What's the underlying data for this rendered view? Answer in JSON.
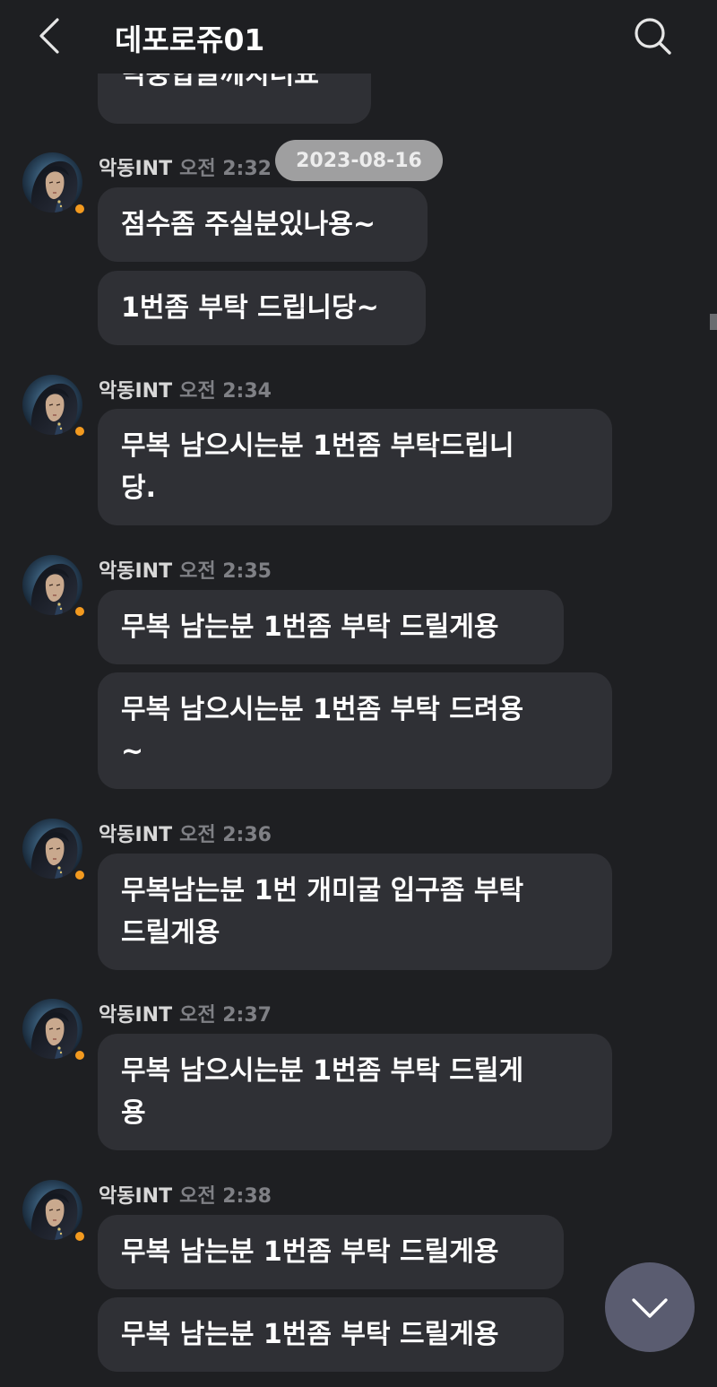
{
  "header": {
    "title": "데포로쥬01",
    "back_icon": "back-arrow-icon",
    "search_icon": "search-icon"
  },
  "date_pill": "2023-08-16",
  "partial_message": "딕중합글께치더묘",
  "groups": [
    {
      "sender": "악동INT",
      "time": "오전 2:32",
      "messages": [
        "점수좀 주실분있나용~",
        "1번좀 부탁 드립니당~"
      ]
    },
    {
      "sender": "악동INT",
      "time": "오전 2:34",
      "messages": [
        "무복 남으시는분 1번좀 부탁드립니\n당."
      ]
    },
    {
      "sender": "악동INT",
      "time": "오전 2:35",
      "messages": [
        "무복 남는분 1번좀 부탁 드릴게용",
        "무복 남으시는분 1번좀 부탁 드려용\n~"
      ]
    },
    {
      "sender": "악동INT",
      "time": "오전 2:36",
      "messages": [
        "무복남는분 1번 개미굴 입구좀 부탁\n드릴게용"
      ]
    },
    {
      "sender": "악동INT",
      "time": "오전 2:37",
      "messages": [
        "무복 남으시는분 1번좀 부탁 드릴게\n용"
      ]
    },
    {
      "sender": "악동INT",
      "time": "오전 2:38",
      "messages": [
        "무복 남는분 1번좀 부탁 드릴게용",
        "무복 남는분 1번좀 부탁 드릴게용"
      ]
    }
  ],
  "colors": {
    "background": "#1e1f22",
    "bubble": "#2f3035",
    "status_dot": "#f39a1f",
    "scroll_button": "#5a5c70"
  }
}
